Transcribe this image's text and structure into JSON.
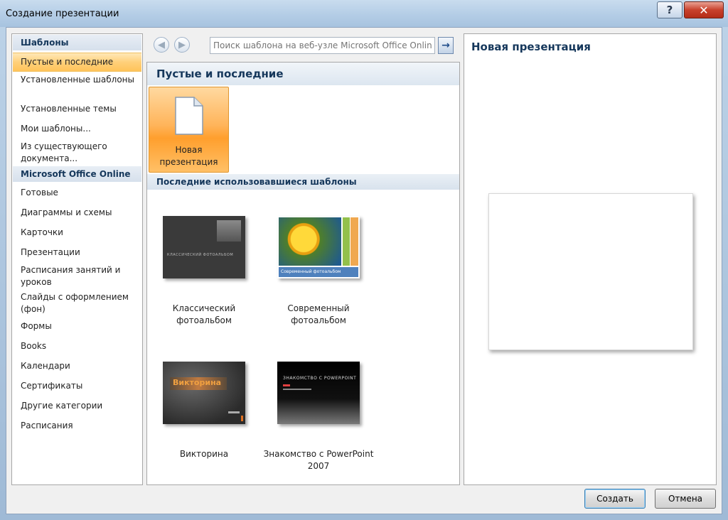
{
  "window": {
    "title": "Создание презентации",
    "help_label": "?",
    "close_label": "✕"
  },
  "left_pane": {
    "templates_header": "Шаблоны",
    "templates_items": [
      "Пустые и последние",
      "Установленные шаблоны",
      "Установленные темы",
      "Мои шаблоны...",
      "Из существующего документа..."
    ],
    "selected_index": 0,
    "online_header": "Microsoft Office Online",
    "online_items": [
      "Готовые",
      "Диаграммы и схемы",
      "Карточки",
      "Презентации",
      "Расписания занятий и уроков",
      "Слайды с оформлением (фон)",
      "Формы",
      "Books",
      "Календари",
      "Сертификаты",
      "Другие категории",
      "Расписания"
    ]
  },
  "toolbar": {
    "back_icon": "◀",
    "forward_icon": "▶",
    "search_placeholder": "Поиск шаблона на веб-узле Microsoft Office Online",
    "go_icon": "→"
  },
  "middle_pane": {
    "header": "Пустые и последние",
    "new_tile_label": "Новая презентация",
    "recent_header": "Последние использовавшиеся шаблоны",
    "recent_templates": [
      {
        "label": "Классический фотоальбом",
        "thumb_text": "КЛАССИЧЕСКИЙ ФОТОАЛЬБОМ"
      },
      {
        "label": "Современный фотоальбом",
        "thumb_text": "Современный фотоальбом"
      },
      {
        "label": "Викторина",
        "thumb_text": "Викторина"
      },
      {
        "label": "Знакомство с PowerPoint 2007",
        "thumb_text": "ЗНАКОМСТВО С POWERPOINT"
      }
    ]
  },
  "preview_pane": {
    "title": "Новая презентация"
  },
  "buttons": {
    "create": "Создать",
    "cancel": "Отмена"
  },
  "colors": {
    "accent_header": "#15375b",
    "selection": "#ffc45a"
  }
}
